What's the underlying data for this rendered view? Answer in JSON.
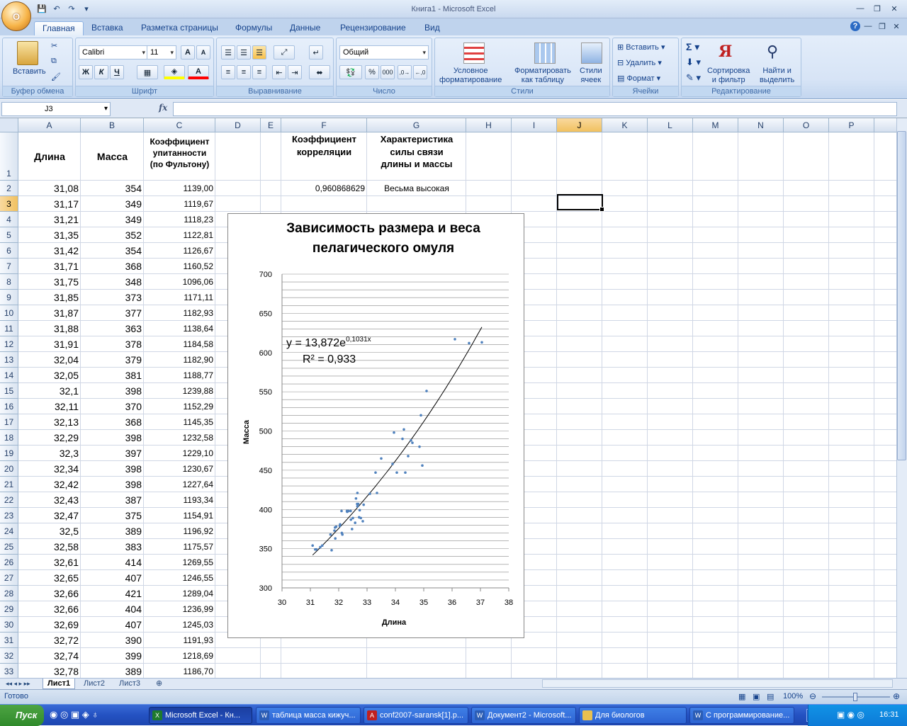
{
  "window": {
    "title": "Книга1 - Microsoft Excel",
    "office_button": "O"
  },
  "tabs": [
    "Главная",
    "Вставка",
    "Разметка страницы",
    "Формулы",
    "Данные",
    "Рецензирование",
    "Вид"
  ],
  "ribbon": {
    "clipboard": {
      "label": "Буфер обмена",
      "paste": "Вставить"
    },
    "font": {
      "label": "Шрифт",
      "name": "Calibri",
      "size": "11",
      "bold": "Ж",
      "italic": "К",
      "underline": "Ч"
    },
    "alignment": {
      "label": "Выравнивание"
    },
    "number": {
      "label": "Число",
      "format": "Общий"
    },
    "styles": {
      "label": "Стили",
      "conditional": [
        "Условное",
        "форматирование"
      ],
      "as_table": [
        "Форматировать",
        "как таблицу"
      ],
      "cell_styles": [
        "Стили",
        "ячеек"
      ]
    },
    "cells": {
      "label": "Ячейки",
      "insert": "Вставить",
      "delete": "Удалить",
      "format": "Формат"
    },
    "editing": {
      "label": "Редактирование",
      "sort": [
        "Сортировка",
        "и фильтр"
      ],
      "find": [
        "Найти и",
        "выделить"
      ]
    }
  },
  "formula_bar": {
    "name_box": "J3",
    "fx": "fx",
    "value": ""
  },
  "columns": [
    "A",
    "B",
    "C",
    "D",
    "E",
    "F",
    "G",
    "H",
    "I",
    "J",
    "K",
    "L",
    "M",
    "N",
    "O",
    "P"
  ],
  "selected_column": "J",
  "selected_row": "3",
  "header_row": {
    "row_num": "1",
    "a": "Длина",
    "b": "Масса",
    "c": [
      "Коэффициент",
      "упитанности",
      "(по Фультону)"
    ],
    "f": [
      "Коэффициент",
      "корреляции"
    ],
    "g": [
      "Характеристика",
      "силы связи",
      "длины и массы"
    ]
  },
  "f2": "0,960868629",
  "g2": "Весьма высокая",
  "rows": [
    {
      "n": "2",
      "a": "31,08",
      "b": "354",
      "c": "1139,00"
    },
    {
      "n": "3",
      "a": "31,17",
      "b": "349",
      "c": "1119,67"
    },
    {
      "n": "4",
      "a": "31,21",
      "b": "349",
      "c": "1118,23"
    },
    {
      "n": "5",
      "a": "31,35",
      "b": "352",
      "c": "1122,81"
    },
    {
      "n": "6",
      "a": "31,42",
      "b": "354",
      "c": "1126,67"
    },
    {
      "n": "7",
      "a": "31,71",
      "b": "368",
      "c": "1160,52"
    },
    {
      "n": "8",
      "a": "31,75",
      "b": "348",
      "c": "1096,06"
    },
    {
      "n": "9",
      "a": "31,85",
      "b": "373",
      "c": "1171,11"
    },
    {
      "n": "10",
      "a": "31,87",
      "b": "377",
      "c": "1182,93"
    },
    {
      "n": "11",
      "a": "31,88",
      "b": "363",
      "c": "1138,64"
    },
    {
      "n": "12",
      "a": "31,91",
      "b": "378",
      "c": "1184,58"
    },
    {
      "n": "13",
      "a": "32,04",
      "b": "379",
      "c": "1182,90"
    },
    {
      "n": "14",
      "a": "32,05",
      "b": "381",
      "c": "1188,77"
    },
    {
      "n": "15",
      "a": "32,1",
      "b": "398",
      "c": "1239,88"
    },
    {
      "n": "16",
      "a": "32,11",
      "b": "370",
      "c": "1152,29"
    },
    {
      "n": "17",
      "a": "32,13",
      "b": "368",
      "c": "1145,35"
    },
    {
      "n": "18",
      "a": "32,29",
      "b": "398",
      "c": "1232,58"
    },
    {
      "n": "19",
      "a": "32,3",
      "b": "397",
      "c": "1229,10"
    },
    {
      "n": "20",
      "a": "32,34",
      "b": "398",
      "c": "1230,67"
    },
    {
      "n": "21",
      "a": "32,42",
      "b": "398",
      "c": "1227,64"
    },
    {
      "n": "22",
      "a": "32,43",
      "b": "387",
      "c": "1193,34"
    },
    {
      "n": "23",
      "a": "32,47",
      "b": "375",
      "c": "1154,91"
    },
    {
      "n": "24",
      "a": "32,5",
      "b": "389",
      "c": "1196,92"
    },
    {
      "n": "25",
      "a": "32,58",
      "b": "383",
      "c": "1175,57"
    },
    {
      "n": "26",
      "a": "32,61",
      "b": "414",
      "c": "1269,55"
    },
    {
      "n": "27",
      "a": "32,65",
      "b": "407",
      "c": "1246,55"
    },
    {
      "n": "28",
      "a": "32,66",
      "b": "421",
      "c": "1289,04"
    },
    {
      "n": "29",
      "a": "32,66",
      "b": "404",
      "c": "1236,99"
    },
    {
      "n": "30",
      "a": "32,69",
      "b": "407",
      "c": "1245,03"
    },
    {
      "n": "31",
      "a": "32,72",
      "b": "390",
      "c": "1191,93"
    },
    {
      "n": "32",
      "a": "32,74",
      "b": "399",
      "c": "1218,69"
    },
    {
      "n": "33",
      "a": "32,78",
      "b": "389",
      "c": "1186,70"
    }
  ],
  "chart_data": {
    "type": "scatter",
    "title": [
      "Зависимость размера и веса",
      "пелагического омуля"
    ],
    "xlabel": "Длина",
    "ylabel": "Масса",
    "xlim": [
      30,
      38
    ],
    "ylim": [
      300,
      700
    ],
    "xticks": [
      30,
      31,
      32,
      33,
      34,
      35,
      36,
      37,
      38
    ],
    "yticks": [
      300,
      350,
      400,
      450,
      500,
      550,
      600,
      650,
      700
    ],
    "grid": "horizontal",
    "trendline": {
      "type": "exponential",
      "a": 13.872,
      "b": 0.1031,
      "x_from": 31.08,
      "x_to": 37.05
    },
    "equation": {
      "base": "y = 13,872e",
      "exp": "0,1031x",
      "r2": "R² = 0,933"
    },
    "points": [
      [
        31.08,
        354
      ],
      [
        31.17,
        349
      ],
      [
        31.21,
        349
      ],
      [
        31.35,
        352
      ],
      [
        31.42,
        354
      ],
      [
        31.71,
        368
      ],
      [
        31.75,
        348
      ],
      [
        31.85,
        373
      ],
      [
        31.87,
        377
      ],
      [
        31.88,
        363
      ],
      [
        31.91,
        378
      ],
      [
        32.04,
        379
      ],
      [
        32.05,
        381
      ],
      [
        32.1,
        398
      ],
      [
        32.11,
        370
      ],
      [
        32.13,
        368
      ],
      [
        32.29,
        398
      ],
      [
        32.3,
        397
      ],
      [
        32.34,
        398
      ],
      [
        32.42,
        398
      ],
      [
        32.43,
        387
      ],
      [
        32.47,
        375
      ],
      [
        32.5,
        389
      ],
      [
        32.58,
        383
      ],
      [
        32.61,
        414
      ],
      [
        32.65,
        407
      ],
      [
        32.66,
        421
      ],
      [
        32.66,
        404
      ],
      [
        32.69,
        407
      ],
      [
        32.72,
        390
      ],
      [
        32.74,
        399
      ],
      [
        32.78,
        389
      ],
      [
        32.85,
        385
      ],
      [
        32.88,
        406
      ],
      [
        33.1,
        420
      ],
      [
        33.3,
        447
      ],
      [
        33.35,
        421
      ],
      [
        33.5,
        465
      ],
      [
        33.9,
        458
      ],
      [
        33.95,
        498
      ],
      [
        34.05,
        447
      ],
      [
        34.25,
        490
      ],
      [
        34.3,
        502
      ],
      [
        34.35,
        447
      ],
      [
        34.45,
        468
      ],
      [
        34.55,
        488
      ],
      [
        34.6,
        485
      ],
      [
        34.85,
        480
      ],
      [
        34.9,
        520
      ],
      [
        34.95,
        456
      ],
      [
        35.1,
        551
      ],
      [
        36.1,
        617
      ],
      [
        36.6,
        612
      ],
      [
        37.05,
        613
      ]
    ]
  },
  "sheets": [
    "Лист1",
    "Лист2",
    "Лист3"
  ],
  "active_sheet": "Лист1",
  "status": {
    "ready": "Готово",
    "zoom": "100%"
  },
  "taskbar": {
    "start": "Пуск",
    "items": [
      "Microsoft Excel - Кн...",
      "таблица масса кижуч...",
      "conf2007-saransk[1].p...",
      "Документ2 - Microsoft...",
      "Для биологов",
      "С программирование..."
    ],
    "lang": "RU",
    "time": "16:31"
  }
}
